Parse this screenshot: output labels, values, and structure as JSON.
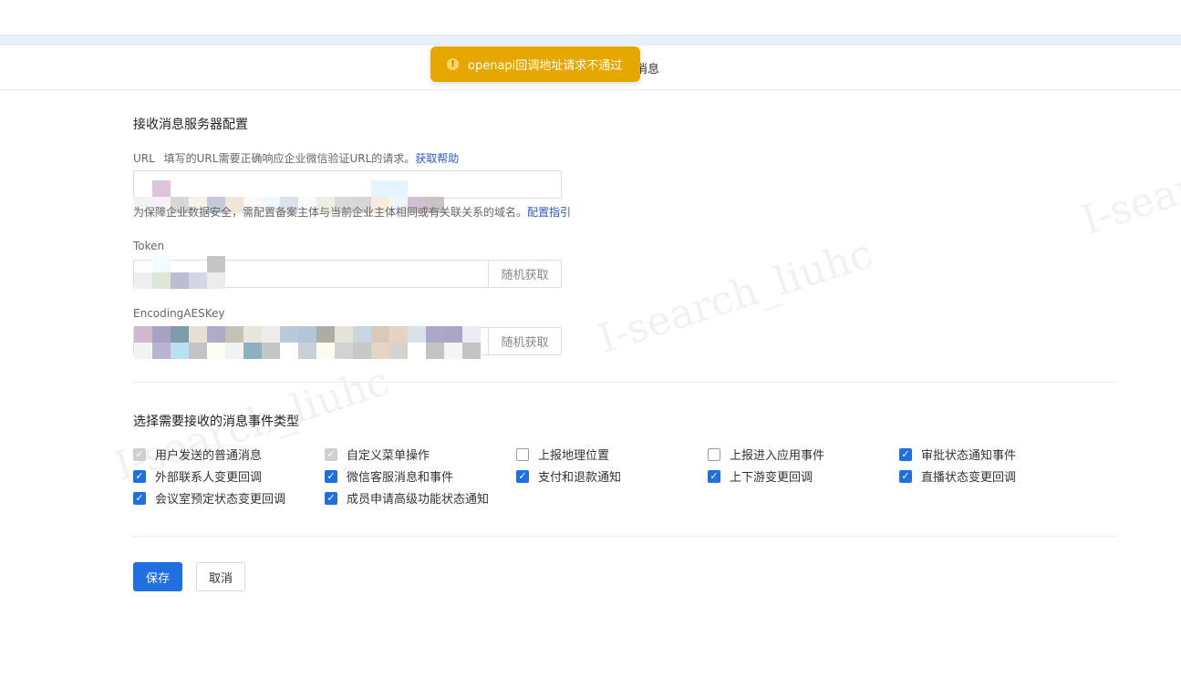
{
  "toast": {
    "icon": "warning-icon",
    "message": "openapi回调地址请求不通过"
  },
  "tab_partial": "消息",
  "server_config": {
    "title": "接收消息服务器配置",
    "url": {
      "label": "URL",
      "help": "填写的URL需要正确响应企业微信验证URL的请求。",
      "help_link": "获取帮助",
      "value": "",
      "note": "为保障企业数据安全，需配置备案主体与当前企业主体相同或有关联关系的域名。",
      "note_link": "配置指引"
    },
    "token": {
      "label": "Token",
      "value": "",
      "button": "随机获取"
    },
    "aes": {
      "label": "EncodingAESKey",
      "value": "",
      "button": "随机获取"
    }
  },
  "events": {
    "title": "选择需要接收的消息事件类型",
    "items": [
      {
        "label": "用户发送的普通消息",
        "state": "disabled"
      },
      {
        "label": "自定义菜单操作",
        "state": "disabled"
      },
      {
        "label": "上报地理位置",
        "state": "unchecked"
      },
      {
        "label": "上报进入应用事件",
        "state": "unchecked"
      },
      {
        "label": "审批状态通知事件",
        "state": "checked"
      },
      {
        "label": "外部联系人变更回调",
        "state": "checked"
      },
      {
        "label": "微信客服消息和事件",
        "state": "checked"
      },
      {
        "label": "支付和退款通知",
        "state": "checked"
      },
      {
        "label": "上下游变更回调",
        "state": "checked"
      },
      {
        "label": "直播状态变更回调",
        "state": "checked"
      },
      {
        "label": "会议室预定状态变更回调",
        "state": "checked"
      },
      {
        "label": "成员申请高级功能状态通知",
        "state": "checked"
      }
    ]
  },
  "actions": {
    "save": "保存",
    "cancel": "取消"
  },
  "colors": {
    "primary": "#1f6fe0",
    "toast_bg": "#e6a800",
    "link": "#2b5cc9"
  },
  "watermark": "I-search_liuhc"
}
